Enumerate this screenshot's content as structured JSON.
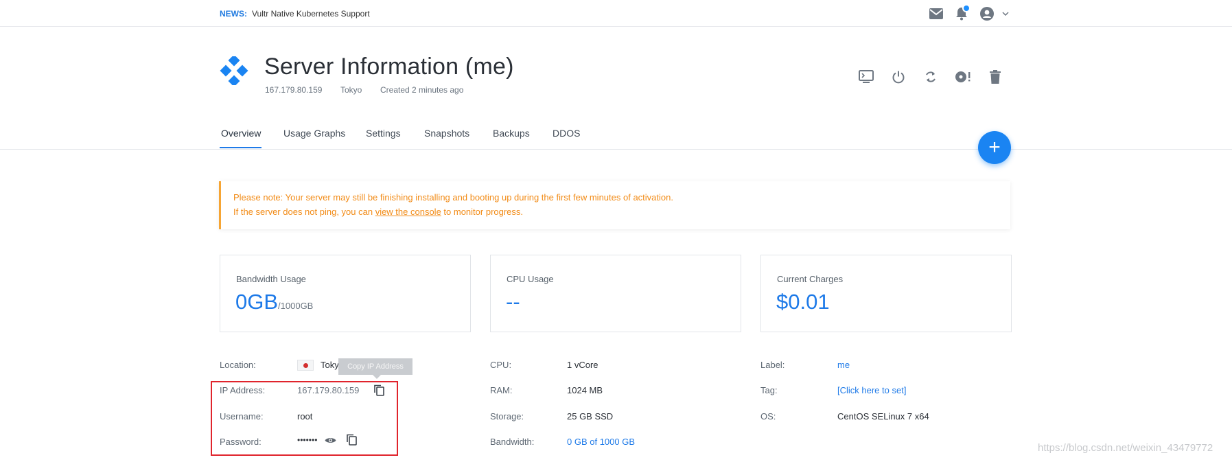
{
  "news": {
    "label": "NEWS:",
    "text": "Vultr Native Kubernetes Support"
  },
  "header": {
    "title": "Server Information (me)",
    "ip": "167.179.80.159",
    "location": "Tokyo",
    "created": "Created 2 minutes ago"
  },
  "tabs": [
    {
      "label": "Overview",
      "active": true
    },
    {
      "label": "Usage Graphs"
    },
    {
      "label": "Settings"
    },
    {
      "label": "Snapshots"
    },
    {
      "label": "Backups"
    },
    {
      "label": "DDOS"
    }
  ],
  "alert": {
    "line1": "Please note: Your server may still be finishing installing and booting up during the first few minutes of activation.",
    "line2_prefix": "If the server does not ping, you can ",
    "line2_link": "view the console",
    "line2_suffix": " to monitor progress."
  },
  "cards": [
    {
      "label": "Bandwidth Usage",
      "value": "0GB",
      "unit": "/1000GB"
    },
    {
      "label": "CPU Usage",
      "value": "--",
      "unit": ""
    },
    {
      "label": "Current Charges",
      "value": "$0.01",
      "unit": ""
    }
  ],
  "info": {
    "location_label": "Location:",
    "location_value": "Tokyo",
    "ip_label": "IP Address:",
    "ip_value": "167.179.80.159",
    "copy_tooltip": "Copy IP Address",
    "username_label": "Username:",
    "username_value": "root",
    "password_label": "Password:",
    "password_value": "•••••••",
    "cpu_label": "CPU:",
    "cpu_value": "1 vCore",
    "ram_label": "RAM:",
    "ram_value": "1024 MB",
    "storage_label": "Storage:",
    "storage_value": "25 GB SSD",
    "bandwidth_label": "Bandwidth:",
    "bandwidth_value": "0 GB of 1000 GB",
    "label_label": "Label:",
    "label_value": "me",
    "tag_label": "Tag:",
    "tag_value": "[Click here to set]",
    "os_label": "OS:",
    "os_value": "CentOS SELinux 7 x64"
  },
  "watermark": "https://blog.csdn.net/weixin_43479772",
  "colors": {
    "accent": "#1e7ae8",
    "alert": "#f28b16",
    "highlight": "#e0242c"
  },
  "icons": {
    "header": [
      "mail-icon",
      "bell-icon",
      "user-avatar-icon",
      "chevron-down-icon"
    ],
    "actions": [
      "console-icon",
      "power-icon",
      "restart-icon",
      "reinstall-icon",
      "trash-icon"
    ]
  }
}
